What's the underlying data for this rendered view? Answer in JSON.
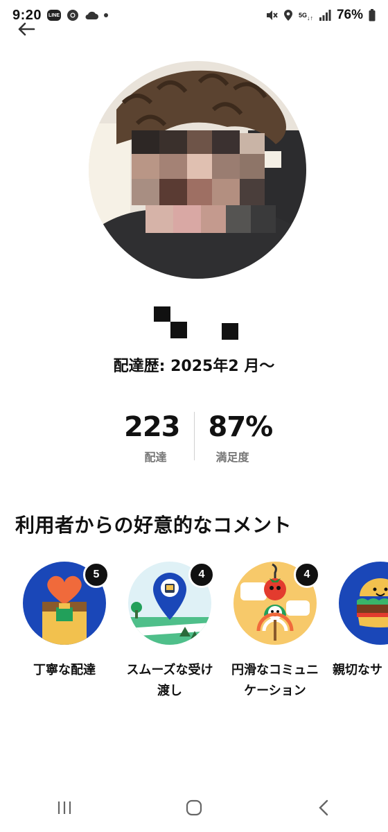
{
  "status_bar": {
    "time": "9:20",
    "line_app": "LINE",
    "network": "5G",
    "battery": "76%"
  },
  "profile": {
    "delivery_history": "配達歴: 2025年2 月〜"
  },
  "stats": {
    "deliveries_value": "223",
    "deliveries_label": "配達",
    "satisfaction_value": "87%",
    "satisfaction_label": "満足度"
  },
  "compliments": {
    "title": "利用者からの好意的なコメント",
    "items": [
      {
        "label": "丁寧な配達",
        "count": "5",
        "icon": "heart-bag-icon"
      },
      {
        "label": "スムーズな受け渡し",
        "count": "4",
        "icon": "map-pin-icon"
      },
      {
        "label": "円滑なコミュニケーション",
        "count": "4",
        "icon": "tomato-chat-icon"
      },
      {
        "label": "親切なサ",
        "count": "",
        "icon": "burger-icon"
      }
    ],
    "lines": {
      "item0": "丁寧な配達",
      "item1a": "スムーズな受け",
      "item1b": "渡し",
      "item2a": "円滑なコミュニ",
      "item2b": "ケーション",
      "item3": "親切なサ"
    }
  },
  "colors": {
    "icon_blue": "#1a47b8",
    "badge_black": "#111111",
    "label_gray": "#767676"
  }
}
